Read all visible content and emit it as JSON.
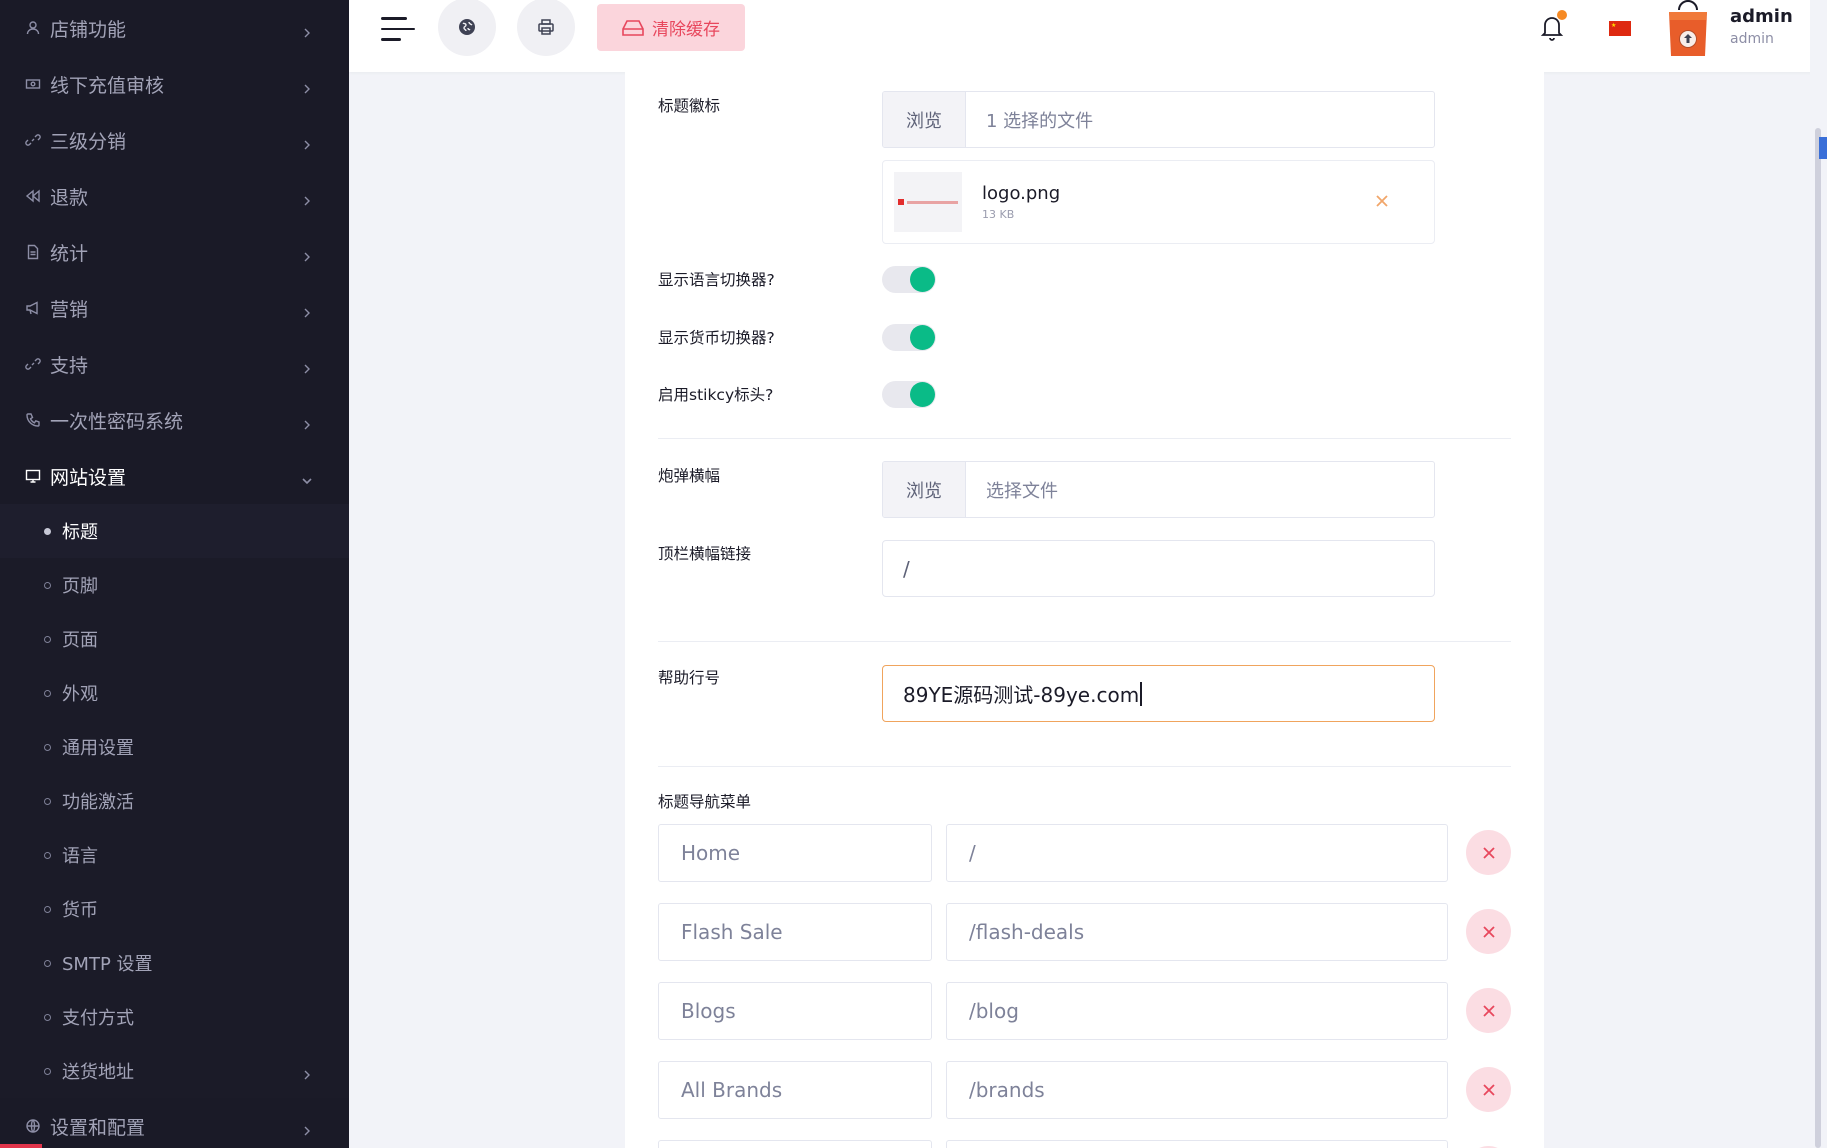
{
  "sidebar": {
    "items": [
      {
        "label": "店铺功能",
        "icon": "user-icon"
      },
      {
        "label": "线下充值审核",
        "icon": "money-icon"
      },
      {
        "label": "三级分销",
        "icon": "link-icon"
      },
      {
        "label": "退款",
        "icon": "backward-icon"
      },
      {
        "label": "统计",
        "icon": "document-icon"
      },
      {
        "label": "营销",
        "icon": "megaphone-icon"
      },
      {
        "label": "支持",
        "icon": "link-icon"
      },
      {
        "label": "一次性密码系统",
        "icon": "phone-icon"
      },
      {
        "label": "网站设置",
        "icon": "desktop-icon"
      }
    ],
    "sub_items": [
      {
        "label": "标题",
        "active": true
      },
      {
        "label": "页脚"
      },
      {
        "label": "页面"
      },
      {
        "label": "外观"
      },
      {
        "label": "通用设置"
      },
      {
        "label": "功能激活"
      },
      {
        "label": "语言"
      },
      {
        "label": "货币"
      },
      {
        "label": "SMTP 设置"
      },
      {
        "label": "支付方式"
      },
      {
        "label": "送货地址"
      }
    ],
    "last_item": {
      "label": "设置和配置",
      "icon": "globe-icon"
    }
  },
  "header": {
    "clear_cache_label": "清除缓存",
    "user_name": "admin",
    "user_role": "admin",
    "flag_icon": "china-flag-icon"
  },
  "form": {
    "header_logo_label": "标题徽标",
    "browse_label": "浏览",
    "header_logo_file_text": "1 选择的文件",
    "logo_file_name": "logo.png",
    "logo_file_size": "13 KB",
    "show_language_switcher_label": "显示语言切换器?",
    "show_currency_switcher_label": "显示货币切换器?",
    "enable_sticky_header_label": "启用stikcy标头?",
    "toggles": {
      "language": true,
      "currency": true,
      "sticky": true
    },
    "popup_banner_label": "炮弹横幅",
    "popup_banner_file_text": "选择文件",
    "top_banner_link_label": "顶栏横幅链接",
    "top_banner_link_value": "/",
    "help_line_label": "帮助行号",
    "help_line_value": "89YE源码测试-89ye.com",
    "header_nav_menu_label": "标题导航菜单",
    "nav_menu": [
      {
        "name": "Home",
        "url": "/"
      },
      {
        "name": "Flash Sale",
        "url": "/flash-deals"
      },
      {
        "name": "Blogs",
        "url": "/blog"
      },
      {
        "name": "All Brands",
        "url": "/brands"
      }
    ]
  },
  "colors": {
    "sidebar_bg": "#1a1a27",
    "accent_pink": "#e8475d",
    "toggle_on": "#0abb87",
    "focus_border": "#f0a45d"
  }
}
